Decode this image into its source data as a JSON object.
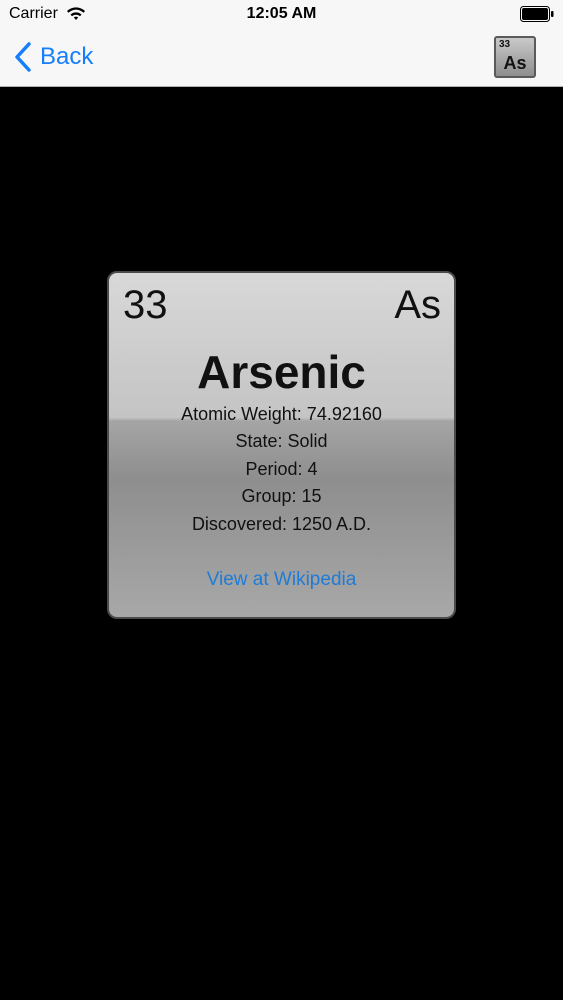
{
  "status_bar": {
    "carrier": "Carrier",
    "time": "12:05 AM"
  },
  "nav": {
    "back_label": "Back",
    "thumbnail": {
      "number": "33",
      "symbol": "As"
    }
  },
  "element": {
    "number": "33",
    "symbol": "As",
    "name": "Arsenic",
    "atomic_weight": "Atomic Weight: 74.92160",
    "state": "State: Solid",
    "period": "Period: 4",
    "group": "Group: 15",
    "discovered": "Discovered: 1250 A.D.",
    "link_label": "View at Wikipedia"
  },
  "colors": {
    "accent": "#157efb",
    "link": "#1e7bd8",
    "background": "#000000"
  }
}
